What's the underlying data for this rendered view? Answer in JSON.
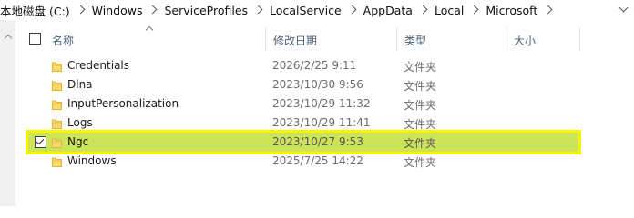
{
  "address_bar": {
    "segments": [
      "本地磁盘 (C:)",
      "Windows",
      "ServiceProfiles",
      "LocalService",
      "AppData",
      "Local",
      "Microsoft"
    ]
  },
  "columns": {
    "name": "名称",
    "date": "修改日期",
    "type": "类型",
    "size": "大小"
  },
  "files": [
    {
      "name": "Credentials",
      "date": "2026/2/25 9:11",
      "type": "文件夹",
      "selected": false
    },
    {
      "name": "Dlna",
      "date": "2023/10/30 9:56",
      "type": "文件夹",
      "selected": false
    },
    {
      "name": "InputPersonalization",
      "date": "2023/10/29 11:32",
      "type": "文件夹",
      "selected": false
    },
    {
      "name": "Logs",
      "date": "2023/10/29 11:41",
      "type": "文件夹",
      "selected": false
    },
    {
      "name": "Ngc",
      "date": "2023/10/27 9:53",
      "type": "文件夹",
      "selected": true
    },
    {
      "name": "Windows",
      "date": "2025/7/25 14:22",
      "type": "文件夹",
      "selected": false
    }
  ],
  "colors": {
    "selection_fill": "#cce35a",
    "selection_outline": "#f5f500",
    "folder": "#ffd86b"
  }
}
